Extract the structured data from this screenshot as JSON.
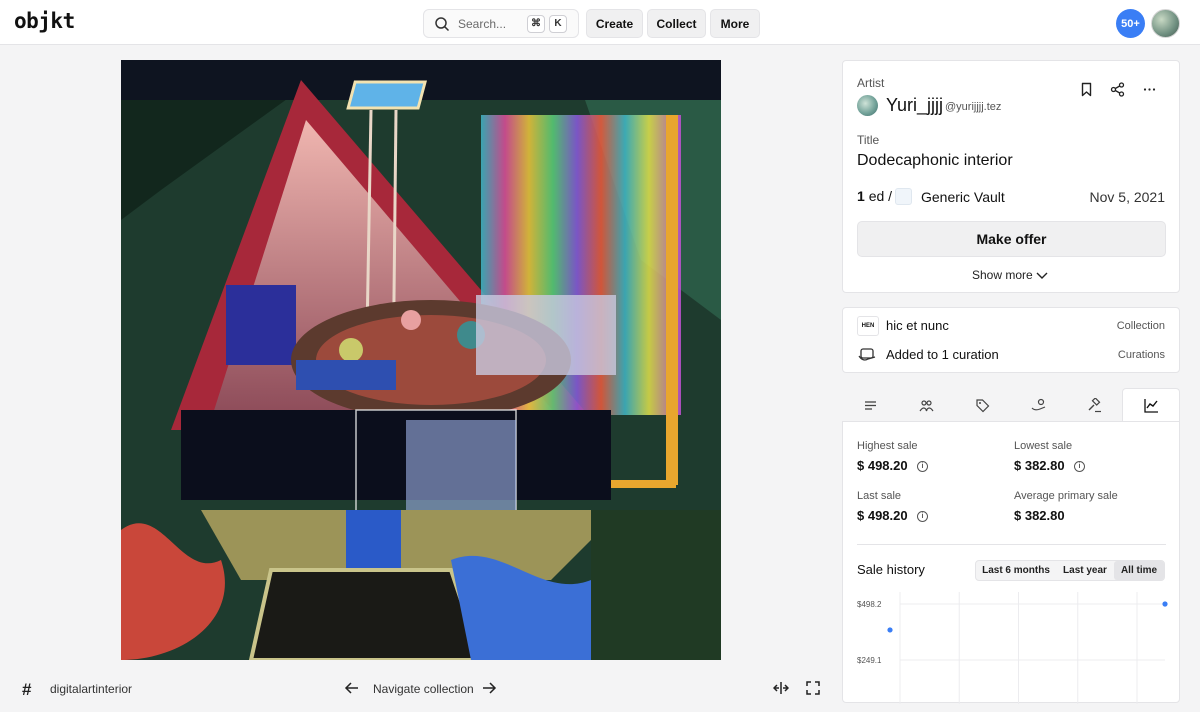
{
  "header": {
    "logo": "objkt",
    "search_placeholder": "Search...",
    "shortcut_keys": [
      "⌘",
      "K"
    ],
    "nav": [
      "Create",
      "Collect",
      "More"
    ],
    "notifications": "50+"
  },
  "artwork": {
    "tag": "digitalartinterior",
    "navigate_label": "Navigate collection"
  },
  "details": {
    "artist_label": "Artist",
    "artist_name": "Yuri_jjjj",
    "artist_handle": "@yurijjjj.tez",
    "title_label": "Title",
    "title": "Dodecaphonic interior",
    "editions": "1",
    "editions_unit": "ed /",
    "vault": "Generic Vault",
    "date": "Nov 5, 2021",
    "offer_button": "Make offer",
    "show_more": "Show more"
  },
  "collection": {
    "name": "hic et nunc",
    "name_type": "Collection",
    "hen_badge": "HEN",
    "curation": "Added to 1 curation",
    "curation_type": "Curations"
  },
  "tabs": [
    "description-icon",
    "holders-icon",
    "listings-icon",
    "offers-icon",
    "auctions-icon",
    "stats-icon"
  ],
  "stats": {
    "highest_label": "Highest sale",
    "highest_value": "$ 498.20",
    "lowest_label": "Lowest sale",
    "lowest_value": "$ 382.80",
    "last_label": "Last sale",
    "last_value": "$ 498.20",
    "avg_label": "Average primary sale",
    "avg_value": "$ 382.80"
  },
  "sale_history": {
    "title": "Sale history",
    "ranges": [
      "Last 6 months",
      "Last year",
      "All time"
    ],
    "selected_range": "All time"
  },
  "chart_data": {
    "type": "scatter",
    "y_ticks": [
      "$498.2",
      "$249.1"
    ],
    "ylim": [
      0,
      498.2
    ],
    "points": [
      {
        "y": 382.8
      },
      {
        "y": 498.2
      }
    ],
    "grid": true
  },
  "colors": {
    "accent": "#3a7ef5",
    "point": "#3a7ef5"
  }
}
